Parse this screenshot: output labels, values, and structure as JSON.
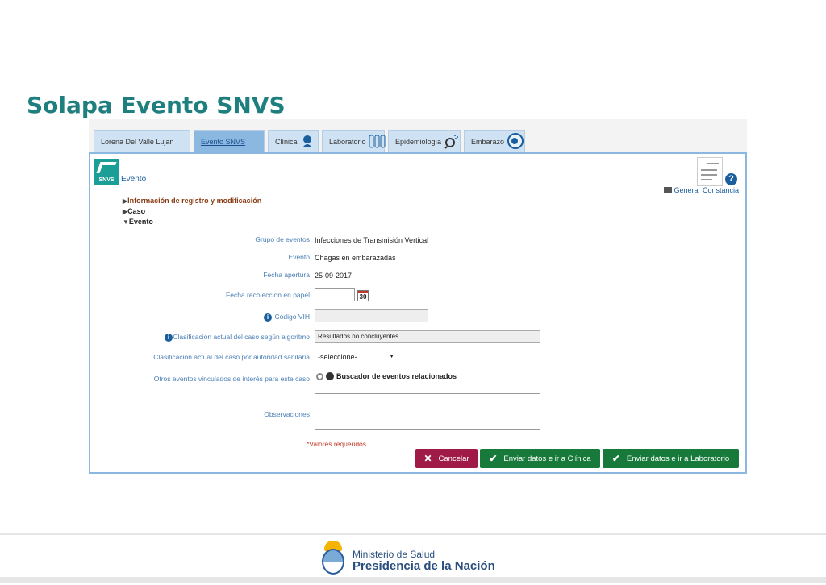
{
  "slide": {
    "title": "Solapa Evento SNVS"
  },
  "tabs": [
    {
      "label": "Lorena Del Valle Lujan",
      "active": false
    },
    {
      "label": "Evento SNVS",
      "active": true
    },
    {
      "label": "Clínica",
      "active": false,
      "icon": "stethoscope-icon"
    },
    {
      "label": "Laboratorio",
      "active": false,
      "icon": "test-tubes-icon"
    },
    {
      "label": "Epidemiología",
      "active": false,
      "icon": "magnifier-icon"
    },
    {
      "label": "Embarazo",
      "active": false,
      "icon": "fetus-icon"
    }
  ],
  "panel": {
    "logo_text": "SNVS",
    "title": "Evento",
    "generate_constancia": "Generar Constancia",
    "tree": [
      {
        "label": "Información de registro y modificación",
        "expanded": false
      },
      {
        "label": "Caso",
        "expanded": false
      },
      {
        "label": "Evento",
        "expanded": true
      }
    ]
  },
  "form": {
    "grupo_eventos": {
      "label": "Grupo de eventos",
      "value": "Infecciones de Transmisión Vertical"
    },
    "evento": {
      "label": "Evento",
      "value": "Chagas en embarazadas"
    },
    "fecha_apertura": {
      "label": "Fecha apertura",
      "value": "25-09-2017"
    },
    "fecha_recoleccion": {
      "label": "Fecha recoleccion en papel",
      "value": "",
      "calendar_day": "30"
    },
    "codigo_vih": {
      "label": "Código VIH",
      "value": ""
    },
    "clasif_algoritmo": {
      "label": "Clasificación actual del caso según algoritmo",
      "value": "Resultados no concluyentes"
    },
    "clasif_autoridad": {
      "label": "Clasificación actual del caso por autoridad sanitaria",
      "value": "-seleccione-"
    },
    "otros_eventos": {
      "label": "Otros eventos vinculados de interés para este caso",
      "link": "Buscador de eventos relacionados"
    },
    "observaciones": {
      "label": "Observaciones",
      "value": ""
    },
    "required_note": "*Valores requeridos"
  },
  "buttons": {
    "cancel": "Cancelar",
    "clinica": "Enviar datos e ir a Clínica",
    "laboratorio": "Enviar datos e ir a Laboratorio"
  },
  "footer": {
    "ministry": "Ministerio de Salud",
    "presidency": "Presidencia de la Nación"
  },
  "colors": {
    "title": "#1f7f7f",
    "tab_active": "#8ab8e0",
    "tab": "#cfe2f3",
    "cancel_button": "#a01a47",
    "green_button": "#177a3a",
    "label": "#4a7fb5"
  }
}
